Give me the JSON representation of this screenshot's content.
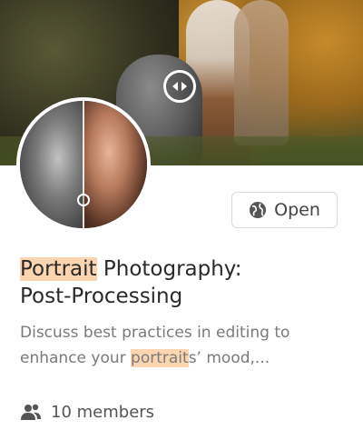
{
  "cover": {
    "image_desc": "Family in autumn park, before/after comparison",
    "compare_icon": "compare-arrows-icon"
  },
  "avatar": {
    "image_desc": "Mother and child portrait, before/after comparison"
  },
  "open_button": {
    "label": "Open",
    "icon": "globe-icon"
  },
  "title": {
    "highlight": "Portrait",
    "rest_line1": " Photography:",
    "line2": "Post-Processing"
  },
  "description": {
    "part1": "Discuss best practices in editing to enhance your ",
    "highlight": "portrait",
    "part2": "s’ mood,..."
  },
  "members": {
    "icon": "people-icon",
    "label": "10 members"
  },
  "colors": {
    "highlight": "#fbd5b0",
    "title_text": "#2a2a2a",
    "desc_text": "#7a7a7a"
  }
}
